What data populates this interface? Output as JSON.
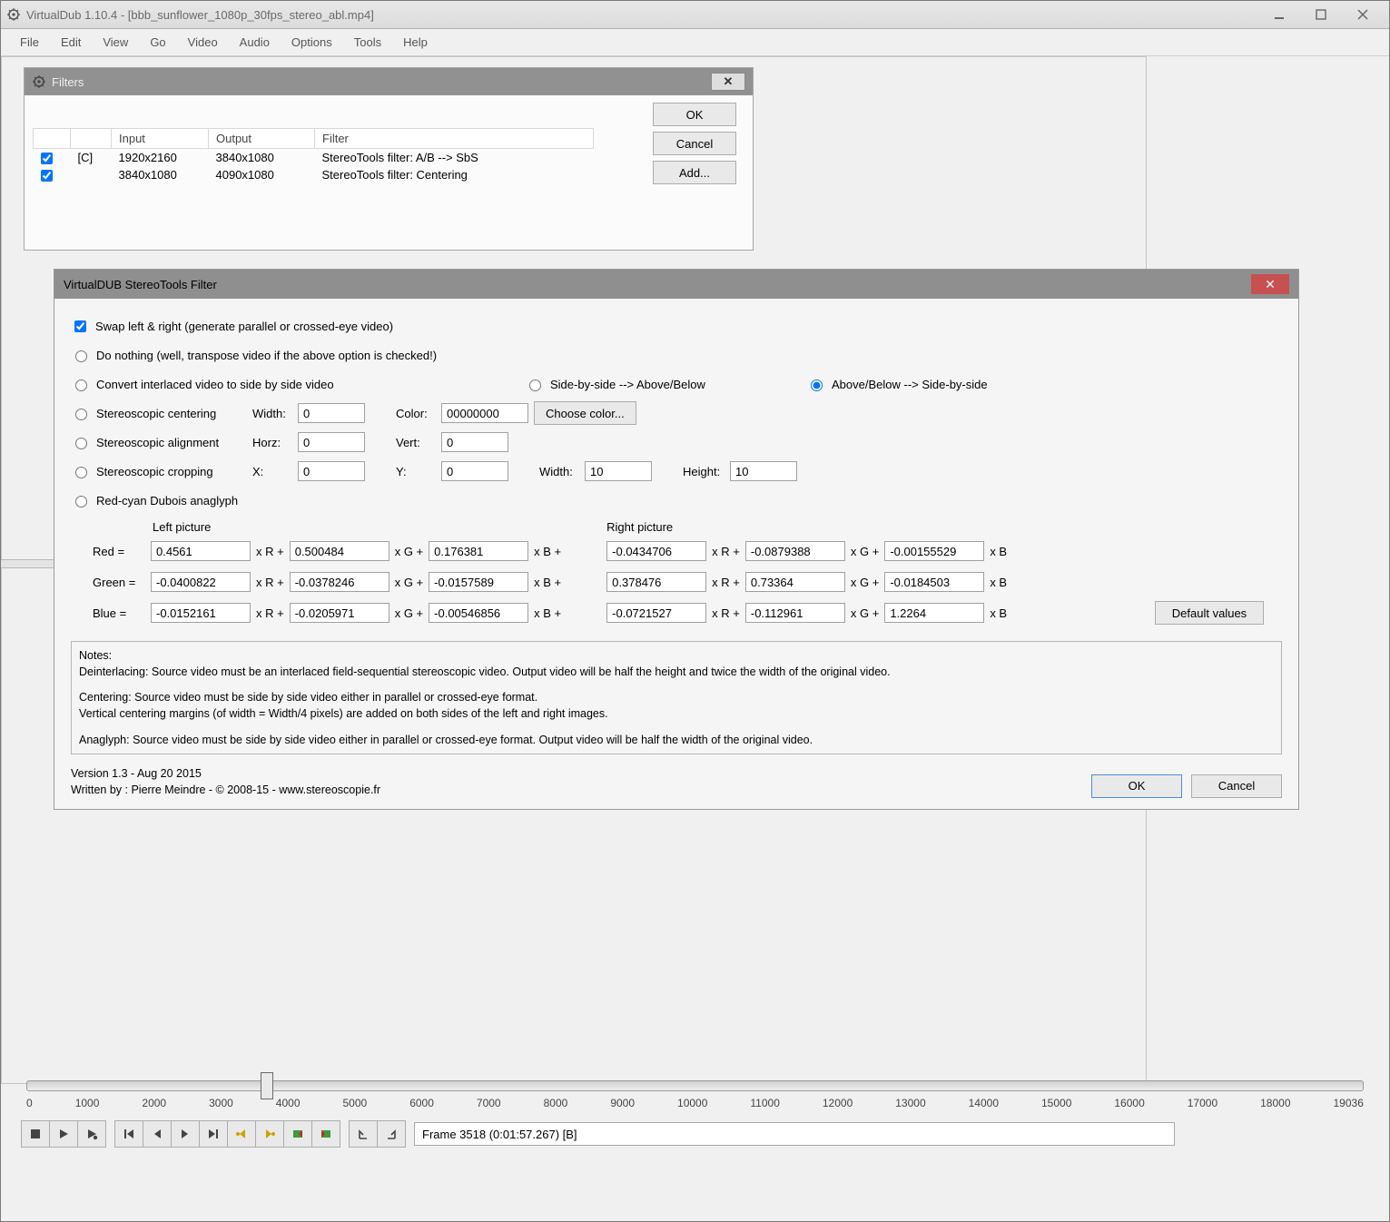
{
  "window": {
    "title": "VirtualDub 1.10.4 - [bbb_sunflower_1080p_30fps_stereo_abl.mp4]"
  },
  "menu": {
    "items": [
      "File",
      "Edit",
      "View",
      "Go",
      "Video",
      "Audio",
      "Options",
      "Tools",
      "Help"
    ]
  },
  "filters_dialog": {
    "title": "Filters",
    "columns": [
      "",
      "",
      "Input",
      "Output",
      "Filter"
    ],
    "rows": [
      {
        "chk": true,
        "flag": "[C]",
        "input": "1920x2160",
        "output": "3840x1080",
        "filter": "StereoTools filter: A/B --> SbS"
      },
      {
        "chk": true,
        "flag": "",
        "input": "3840x1080",
        "output": "4090x1080",
        "filter": "StereoTools filter: Centering"
      }
    ],
    "buttons": {
      "ok": "OK",
      "cancel": "Cancel",
      "add": "Add..."
    }
  },
  "stereo": {
    "title": "VirtualDUB StereoTools Filter",
    "swap_chk": true,
    "swap_label": "Swap left & right (generate parallel or crossed-eye video)",
    "opts": {
      "do_nothing": "Do nothing (well, transpose video if the above option is checked!)",
      "convert": "Convert interlaced video to side by side video",
      "sbs_ab": "Side-by-side --> Above/Below",
      "ab_sbs": "Above/Below --> Side-by-side",
      "centering": "Stereoscopic centering",
      "alignment": "Stereoscopic alignment",
      "cropping": "Stereoscopic cropping",
      "anaglyph": "Red-cyan Dubois anaglyph"
    },
    "labels": {
      "width": "Width:",
      "color": "Color:",
      "choose": "Choose color...",
      "horz": "Horz:",
      "vert": "Vert:",
      "x": "X:",
      "y": "Y:",
      "w2": "Width:",
      "h2": "Height:",
      "left_pic": "Left picture",
      "right_pic": "Right picture",
      "red": "Red =",
      "green": "Green =",
      "blue": "Blue =",
      "xr": "x R +",
      "xg": "x G +",
      "xb": "x B +",
      "xbend": "x B",
      "default": "Default values"
    },
    "vals": {
      "width": "0",
      "color": "00000000",
      "horz": "0",
      "vert": "0",
      "x": "0",
      "y": "0",
      "w2": "10",
      "h2": "10"
    },
    "left": {
      "r": [
        "0.4561",
        "0.500484",
        "0.176381"
      ],
      "g": [
        "-0.0400822",
        "-0.0378246",
        "-0.0157589"
      ],
      "b": [
        "-0.0152161",
        "-0.0205971",
        "-0.00546856"
      ]
    },
    "right": {
      "r": [
        "-0.0434706",
        "-0.0879388",
        "-0.00155529"
      ],
      "g": [
        "0.378476",
        "0.73364",
        "-0.0184503"
      ],
      "b": [
        "-0.0721527",
        "-0.112961",
        "1.2264"
      ]
    },
    "notes_title": "Notes:",
    "notes_l1": "Deinterlacing: Source video must be an interlaced field-sequential stereoscopic video. Output video will be half the height and twice the width of the original video.",
    "notes_l2": "Centering: Source video must be side by side video either in parallel or crossed-eye format.",
    "notes_l3": "Vertical centering margins (of width = Width/4 pixels) are added on both sides of the left and right images.",
    "notes_l4": "Anaglyph: Source video must be side by side video either in parallel or crossed-eye format. Output video will be half the width of the original video.",
    "version": "Version 1.3 - Aug 20 2015",
    "author": "Written by : Pierre Meindre - © 2008-15 - www.stereoscopie.fr",
    "ok": "OK",
    "cancel": "Cancel"
  },
  "timeline": {
    "ticks": [
      "0",
      "1000",
      "2000",
      "3000",
      "4000",
      "5000",
      "6000",
      "7000",
      "8000",
      "9000",
      "10000",
      "11000",
      "12000",
      "13000",
      "14000",
      "15000",
      "16000",
      "17000",
      "18000",
      "19036"
    ]
  },
  "frameinfo": "Frame 3518 (0:01:57.267) [B]"
}
